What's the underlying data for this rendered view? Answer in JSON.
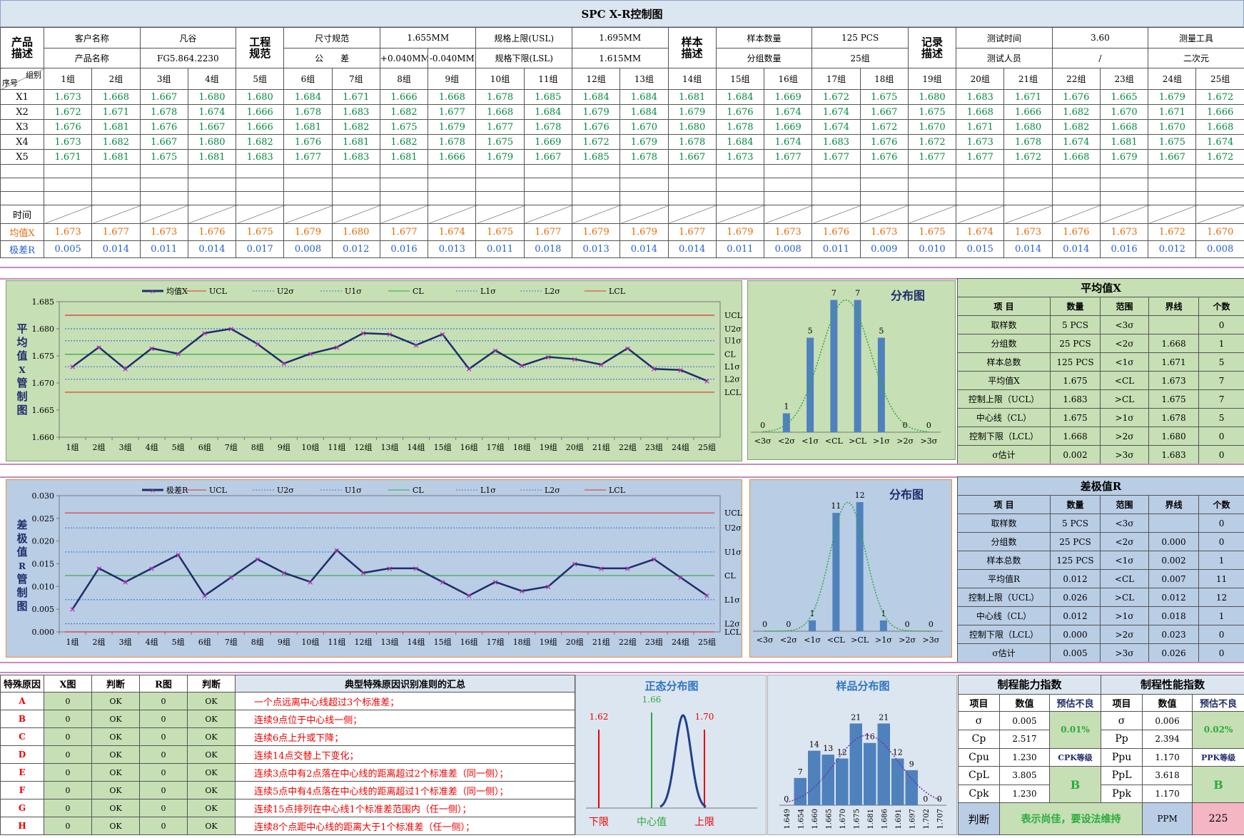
{
  "title": "SPC X-R控制图",
  "product": {
    "section": "产品\n描述",
    "customer_label": "客户名称",
    "customer": "凡谷",
    "name_label": "产品名称",
    "name": "FG5.864.2230"
  },
  "spec": {
    "section": "工程\n规范",
    "size_label": "尺寸规范",
    "size": "1.655MM",
    "tol_label": "公　　差",
    "tol_plus": "+0.040MM",
    "tol_minus": "-0.040MM",
    "usl_label": "规格上限(USL)",
    "usl": "1.695MM",
    "lsl_label": "规格下限(LSL)",
    "lsl": "1.615MM"
  },
  "sample": {
    "section": "样本\n描述",
    "count_label": "样本数量",
    "count": "125 PCS",
    "groups_label": "分组数量",
    "groups": "25组"
  },
  "record": {
    "section": "记录\n描述",
    "time_label": "测试时间",
    "time": "3.60",
    "person_label": "测试人员",
    "person": "/",
    "tool_label": "测量工具",
    "tool": "二次元"
  },
  "table": {
    "corner_top": "组别",
    "corner_bottom": "序号",
    "groups": [
      "1组",
      "2组",
      "3组",
      "4组",
      "5组",
      "6组",
      "7组",
      "8组",
      "9组",
      "10组",
      "11组",
      "12组",
      "13组",
      "14组",
      "15组",
      "16组",
      "17组",
      "18组",
      "19组",
      "20组",
      "21组",
      "22组",
      "23组",
      "24组",
      "25组"
    ],
    "row_labels": [
      "X1",
      "X2",
      "X3",
      "X4",
      "X5"
    ],
    "rows": [
      [
        "1.673",
        "1.668",
        "1.667",
        "1.680",
        "1.680",
        "1.684",
        "1.671",
        "1.666",
        "1.668",
        "1.678",
        "1.685",
        "1.684",
        "1.684",
        "1.681",
        "1.684",
        "1.669",
        "1.672",
        "1.675",
        "1.680",
        "1.683",
        "1.671",
        "1.676",
        "1.665",
        "1.679",
        "1.672"
      ],
      [
        "1.672",
        "1.671",
        "1.678",
        "1.674",
        "1.666",
        "1.678",
        "1.683",
        "1.682",
        "1.677",
        "1.668",
        "1.684",
        "1.679",
        "1.684",
        "1.679",
        "1.676",
        "1.674",
        "1.674",
        "1.667",
        "1.675",
        "1.668",
        "1.666",
        "1.682",
        "1.670",
        "1.671",
        "1.666"
      ],
      [
        "1.676",
        "1.681",
        "1.676",
        "1.667",
        "1.666",
        "1.681",
        "1.682",
        "1.675",
        "1.679",
        "1.677",
        "1.678",
        "1.676",
        "1.670",
        "1.680",
        "1.678",
        "1.669",
        "1.674",
        "1.672",
        "1.670",
        "1.671",
        "1.680",
        "1.682",
        "1.668",
        "1.670",
        "1.668"
      ],
      [
        "1.673",
        "1.682",
        "1.667",
        "1.680",
        "1.682",
        "1.676",
        "1.681",
        "1.682",
        "1.678",
        "1.675",
        "1.669",
        "1.672",
        "1.679",
        "1.678",
        "1.684",
        "1.674",
        "1.683",
        "1.676",
        "1.672",
        "1.673",
        "1.678",
        "1.674",
        "1.681",
        "1.675",
        "1.674"
      ],
      [
        "1.671",
        "1.681",
        "1.675",
        "1.681",
        "1.683",
        "1.677",
        "1.683",
        "1.681",
        "1.666",
        "1.679",
        "1.667",
        "1.685",
        "1.678",
        "1.667",
        "1.673",
        "1.677",
        "1.677",
        "1.676",
        "1.677",
        "1.677",
        "1.672",
        "1.668",
        "1.679",
        "1.667",
        "1.672"
      ]
    ],
    "time_label": "时间",
    "xbar_label": "均值X",
    "range_label": "极差R",
    "xbar": [
      "1.673",
      "1.677",
      "1.673",
      "1.676",
      "1.675",
      "1.679",
      "1.680",
      "1.677",
      "1.674",
      "1.675",
      "1.677",
      "1.679",
      "1.679",
      "1.677",
      "1.679",
      "1.673",
      "1.676",
      "1.673",
      "1.675",
      "1.674",
      "1.673",
      "1.676",
      "1.673",
      "1.672",
      "1.670"
    ],
    "range": [
      "0.005",
      "0.014",
      "0.011",
      "0.014",
      "0.017",
      "0.008",
      "0.012",
      "0.016",
      "0.013",
      "0.011",
      "0.018",
      "0.013",
      "0.014",
      "0.014",
      "0.011",
      "0.008",
      "0.011",
      "0.009",
      "0.010",
      "0.015",
      "0.014",
      "0.014",
      "0.016",
      "0.012",
      "0.008"
    ]
  },
  "chart_data": [
    {
      "type": "line",
      "title": "平均值X管制图",
      "ylabel": "平\n均\n值\nX\n管\n制\n图",
      "ylim": [
        1.66,
        1.685
      ],
      "yticks": [
        "1.685",
        "1.680",
        "1.675",
        "1.670",
        "1.665",
        "1.660"
      ],
      "x": [
        "1组",
        "2组",
        "3组",
        "4组",
        "5组",
        "6组",
        "7组",
        "8组",
        "9组",
        "10组",
        "11组",
        "12组",
        "13组",
        "14组",
        "15组",
        "16组",
        "17组",
        "18组",
        "19组",
        "20组",
        "21组",
        "22组",
        "23组",
        "24组",
        "25组"
      ],
      "series": [
        {
          "name": "均值X",
          "values": [
            1.673,
            1.6766,
            1.6726,
            1.6764,
            1.6754,
            1.6792,
            1.68,
            1.6772,
            1.6736,
            1.6754,
            1.6766,
            1.6792,
            1.679,
            1.677,
            1.679,
            1.6726,
            1.676,
            1.6732,
            1.6748,
            1.6744,
            1.6734,
            1.6764,
            1.6726,
            1.6724,
            1.6704
          ]
        }
      ],
      "legend": [
        "均值X",
        "UCL",
        "U2σ",
        "U1σ",
        "CL",
        "L1σ",
        "L2σ",
        "LCL"
      ],
      "lines": {
        "UCL": 1.6825,
        "U2σ": 1.68,
        "U1σ": 1.6778,
        "CL": 1.6753,
        "L1σ": 1.673,
        "L2σ": 1.6707,
        "LCL": 1.6683
      },
      "right_labels": [
        "UCL",
        "U2σ",
        "U1σ",
        "CL",
        "L1σ",
        "L2σ",
        "LCL"
      ]
    },
    {
      "type": "bar",
      "title": "分布图",
      "categories": [
        "<3σ",
        "<2σ",
        "<1σ",
        "<CL",
        ">CL",
        ">1σ",
        ">2σ",
        ">3σ"
      ],
      "values": [
        0,
        1,
        5,
        7,
        7,
        5,
        0,
        0
      ]
    },
    {
      "type": "line",
      "title": "极差R管制图",
      "ylabel": "差\n极\n值\nR\n管\n制\n图",
      "ylim": [
        0,
        0.03
      ],
      "yticks": [
        "0.030",
        "0.025",
        "0.020",
        "0.015",
        "0.010",
        "0.005",
        "0.000"
      ],
      "x": [
        "1组",
        "2组",
        "3组",
        "4组",
        "5组",
        "6组",
        "7组",
        "8组",
        "9组",
        "10组",
        "11组",
        "12组",
        "13组",
        "14组",
        "15组",
        "16组",
        "17组",
        "18组",
        "19组",
        "20组",
        "21组",
        "22组",
        "23组",
        "24组",
        "25组"
      ],
      "series": [
        {
          "name": "极差R",
          "values": [
            0.005,
            0.014,
            0.011,
            0.014,
            0.017,
            0.008,
            0.012,
            0.016,
            0.013,
            0.011,
            0.018,
            0.013,
            0.014,
            0.014,
            0.011,
            0.008,
            0.011,
            0.009,
            0.01,
            0.015,
            0.014,
            0.014,
            0.016,
            0.012,
            0.008
          ]
        }
      ],
      "legend": [
        "极差R",
        "UCL",
        "U2σ",
        "U1σ",
        "CL",
        "L1σ",
        "L2σ",
        "LCL"
      ],
      "lines": {
        "UCL": 0.0262,
        "U2σ": 0.0229,
        "U1σ": 0.0176,
        "CL": 0.0124,
        "L1σ": 0.0071,
        "L2σ": 0.0018,
        "LCL": 0.0
      },
      "right_labels": [
        "UCL",
        "U2σ",
        "U1σ",
        "CL",
        "L1σ",
        "L2σ",
        "LCL"
      ]
    },
    {
      "type": "bar",
      "title": "分布图",
      "categories": [
        "<3σ",
        "<2σ",
        "<1σ",
        "<CL",
        ">CL",
        ">1σ",
        ">2σ",
        ">3σ"
      ],
      "values": [
        0,
        0,
        1,
        11,
        12,
        1,
        0,
        0
      ]
    },
    {
      "type": "line",
      "title": "正态分布图",
      "labels": {
        "lower_value": "1.62",
        "center_value": "1.66",
        "upper_value": "1.70",
        "lower": "下限",
        "center": "中心值",
        "upper": "上限"
      }
    },
    {
      "type": "bar",
      "title": "样品分布图",
      "categories": [
        "1.649",
        "1.654",
        "1.660",
        "1.665",
        "1.670",
        "1.675",
        "1.681",
        "1.686",
        "1.691",
        "1.697",
        "1.702",
        "1.707"
      ],
      "values": [
        0,
        7,
        14,
        13,
        12,
        21,
        16,
        21,
        12,
        9,
        0,
        0
      ]
    }
  ],
  "xstats": {
    "title": "平均值X",
    "head": [
      "项  目",
      "数量",
      "范围",
      "界线",
      "个数"
    ],
    "rows": [
      [
        "取样数",
        "5 PCS",
        "<3σ",
        "",
        "0"
      ],
      [
        "分组数",
        "25 PCS",
        "<2σ",
        "1.668",
        "1"
      ],
      [
        "样本总数",
        "125 PCS",
        "<1σ",
        "1.671",
        "5"
      ],
      [
        "平均值X",
        "1.675",
        "<CL",
        "1.673",
        "7"
      ],
      [
        "控制上限（UCL）",
        "1.683",
        ">CL",
        "1.675",
        "7"
      ],
      [
        "中心线（CL）",
        "1.675",
        ">1σ",
        "1.678",
        "5"
      ],
      [
        "控制下限（LCL）",
        "1.668",
        ">2σ",
        "1.680",
        "0"
      ],
      [
        "σ估计",
        "0.002",
        ">3σ",
        "1.683",
        "0"
      ]
    ]
  },
  "rstats": {
    "title": "差极值R",
    "head": [
      "项  目",
      "数量",
      "范围",
      "界线",
      "个数"
    ],
    "rows": [
      [
        "取样数",
        "5 PCS",
        "<3σ",
        "",
        "0"
      ],
      [
        "分组数",
        "25 PCS",
        "<2σ",
        "0.000",
        "0"
      ],
      [
        "样本总数",
        "125 PCS",
        "<1σ",
        "0.002",
        "1"
      ],
      [
        "平均值R",
        "0.012",
        "<CL",
        "0.007",
        "11"
      ],
      [
        "控制上限（UCL）",
        "0.026",
        ">CL",
        "0.012",
        "12"
      ],
      [
        "中心线（CL）",
        "0.012",
        ">1σ",
        "0.018",
        "1"
      ],
      [
        "控制下限（LCL）",
        "0.000",
        ">2σ",
        "0.023",
        "0"
      ],
      [
        "σ估计",
        "0.005",
        ">3σ",
        "0.026",
        "0"
      ]
    ]
  },
  "special": {
    "head": [
      "特殊原因",
      "X图",
      "判断",
      "R图",
      "判断",
      "典型特殊原因识别准则的汇总"
    ],
    "rows": [
      [
        "A",
        "0",
        "OK",
        "0",
        "OK",
        "一个点远离中心线超过3个标准差；"
      ],
      [
        "B",
        "0",
        "OK",
        "0",
        "OK",
        "连续9点位于中心线一侧；"
      ],
      [
        "C",
        "0",
        "OK",
        "0",
        "OK",
        "连续6点上升或下降；"
      ],
      [
        "D",
        "0",
        "OK",
        "0",
        "OK",
        "连续14点交替上下变化；"
      ],
      [
        "E",
        "0",
        "OK",
        "0",
        "OK",
        "连续3点中有2点落在中心线的距离超过2个标准差（同一侧）；"
      ],
      [
        "F",
        "0",
        "OK",
        "0",
        "OK",
        "连续5点中有4点落在中心线的距离超过1个标准差（同一侧）；"
      ],
      [
        "G",
        "0",
        "OK",
        "0",
        "OK",
        "连续15点排列在中心线1个标准差范围内（任一侧）；"
      ],
      [
        "H",
        "0",
        "OK",
        "0",
        "OK",
        "连续8个点距中心线的距离大于1个标准差（任一侧）；"
      ]
    ]
  },
  "capability": {
    "title": "制程能力指数",
    "head": [
      "项目",
      "数值",
      "预估不良"
    ],
    "rows": [
      [
        "σ",
        "0.005"
      ],
      [
        "Cp",
        "2.517"
      ],
      [
        "Cpu",
        "1.230"
      ],
      [
        "CpL",
        "3.805"
      ],
      [
        "Cpk",
        "1.230"
      ]
    ],
    "bad": "0.01%",
    "grade_label": "CPK等级",
    "grade": "B"
  },
  "performance": {
    "title": "制程性能指数",
    "head": [
      "项目",
      "数值",
      "预估不良"
    ],
    "rows": [
      [
        "σ",
        "0.006"
      ],
      [
        "Pp",
        "2.394"
      ],
      [
        "Ppu",
        "1.170"
      ],
      [
        "PpL",
        "3.618"
      ],
      [
        "Ppk",
        "1.170"
      ]
    ],
    "bad": "0.02%",
    "grade_label": "PPK等级",
    "grade": "B"
  },
  "judge": {
    "label": "判断",
    "text": "表示尚佳，要设法维持",
    "ppm_label": "PPM",
    "ppm": "225"
  },
  "colors": {
    "xpanel": "#c7dfb5",
    "rpanel": "#b9cde5",
    "line": "#1f2d6b",
    "marker": "#b02fb0",
    "ucl": "#e03030",
    "sigma": "#3a7bd5",
    "cl": "#2bab3c",
    "bar": "#4f81bd",
    "dist": "#2bab3c"
  }
}
